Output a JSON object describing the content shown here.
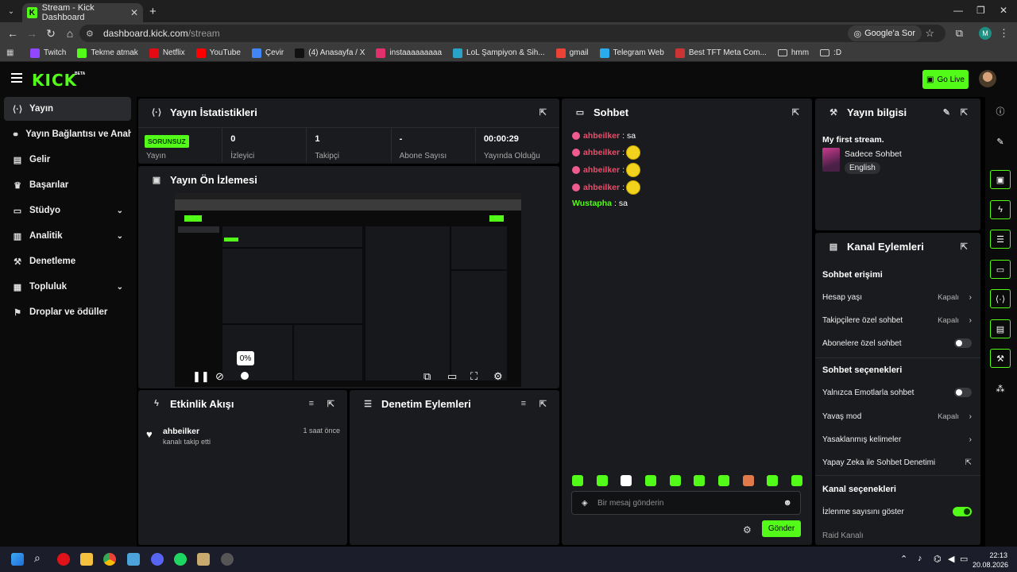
{
  "browser": {
    "tab_title": "Stream - Kick Dashboard",
    "url_host": "dashboard.kick.com",
    "url_path": "/stream",
    "google_label": "Google'a Sor",
    "profile_letter": "M",
    "bookmarks": [
      {
        "label": "Twitch",
        "color": "#9146ff"
      },
      {
        "label": "Tekme atmak",
        "color": "#53fc18"
      },
      {
        "label": "Netflix",
        "color": "#e50914"
      },
      {
        "label": "YouTube",
        "color": "#ff0000"
      },
      {
        "label": "Çevir",
        "color": "#4285f4"
      },
      {
        "label": "(4) Anasayfa / X",
        "color": "#111111"
      },
      {
        "label": "instaaaaaaaaa",
        "color": "#e1306c"
      },
      {
        "label": "LoL Şampiyon & Sih...",
        "color": "#2aa3c9"
      },
      {
        "label": "gmail",
        "color": "#ea4335"
      },
      {
        "label": "Telegram Web",
        "color": "#2aabee"
      },
      {
        "label": "Best TFT Meta Com...",
        "color": "#c33"
      },
      {
        "label": "hmm",
        "color": "transparent"
      },
      {
        "label": ":D",
        "color": "transparent"
      }
    ]
  },
  "header": {
    "logo": "KICK",
    "beta": "BETA",
    "go_live": "Go Live"
  },
  "sidebar": {
    "items": [
      {
        "label": "Yayın",
        "icon": "broadcast-icon"
      },
      {
        "label": "Yayın Bağlantısı ve Anahtarı",
        "icon": "link-icon"
      },
      {
        "label": "Gelir",
        "icon": "revenue-icon"
      },
      {
        "label": "Başarılar",
        "icon": "trophy-icon"
      },
      {
        "label": "Stüdyo",
        "icon": "studio-icon"
      },
      {
        "label": "Analitik",
        "icon": "analytics-icon"
      },
      {
        "label": "Denetleme",
        "icon": "hammer-icon"
      },
      {
        "label": "Topluluk",
        "icon": "community-icon"
      },
      {
        "label": "Droplar ve ödüller",
        "icon": "gift-icon"
      }
    ]
  },
  "stats": {
    "title": "Yayın İstatistikleri",
    "status_badge": "SORUNSUZ",
    "cells": [
      {
        "value": "",
        "label": "Yayın"
      },
      {
        "value": "0",
        "label": "İzleyici"
      },
      {
        "value": "1",
        "label": "Takipçi"
      },
      {
        "value": "-",
        "label": "Abone Sayısı"
      },
      {
        "value": "00:00:29",
        "label": "Yayında Olduğu"
      }
    ]
  },
  "preview": {
    "title": "Yayın Ön İzlemesi",
    "volume_tooltip": "0%"
  },
  "activity": {
    "title": "Etkinlik Akışı",
    "items": [
      {
        "user": "ahbeilker",
        "text": "kanalı takip etti",
        "time": "1 saat önce"
      }
    ]
  },
  "moderation": {
    "title": "Denetim Eylemleri"
  },
  "chat": {
    "title": "Sohbet",
    "messages": [
      {
        "user": "ahbeilker",
        "text": "sa",
        "color": "#ef4b6a"
      },
      {
        "user": "ahbeilker",
        "text": "",
        "color": "#ef4b6a"
      },
      {
        "user": "ahbeilker",
        "text": "",
        "color": "#ef4b6a"
      },
      {
        "user": "ahbeilker",
        "text": "",
        "color": "#ef4b6a"
      },
      {
        "user": "Wustapha",
        "text": "sa",
        "color": "#53fc18"
      }
    ],
    "placeholder": "Bir mesaj gönderin",
    "send": "Gönder"
  },
  "stream_info": {
    "title": "Yayın bilgisi",
    "stream_title": "My first stream.",
    "category": "Sadece Sohbet",
    "language": "English"
  },
  "channel_actions": {
    "title": "Kanal Eylemleri",
    "sections": [
      {
        "heading": "Sohbet erişimi"
      },
      {
        "heading": "Sohbet seçenekleri"
      },
      {
        "heading": "Kanal seçenekleri"
      }
    ],
    "rows": [
      {
        "label": "Hesap yaşı",
        "value": "Kapalı"
      },
      {
        "label": "Takipçilere özel sohbet",
        "value": "Kapalı"
      },
      {
        "label": "Abonelere özel sohbet",
        "value": ""
      },
      {
        "label": "Yalnızca Emotlarla sohbet",
        "value": ""
      },
      {
        "label": "Yavaş mod",
        "value": "Kapalı"
      },
      {
        "label": "Yasaklanmış kelimeler",
        "value": ""
      },
      {
        "label": "Yapay Zeka ile Sohbet Denetimi",
        "value": ""
      },
      {
        "label": "İzlenme sayısını göster",
        "value": ""
      },
      {
        "label": "Raid Kanalı",
        "value": ""
      }
    ]
  },
  "taskbar": {
    "time": "22:13",
    "date": "20.08.2026"
  }
}
